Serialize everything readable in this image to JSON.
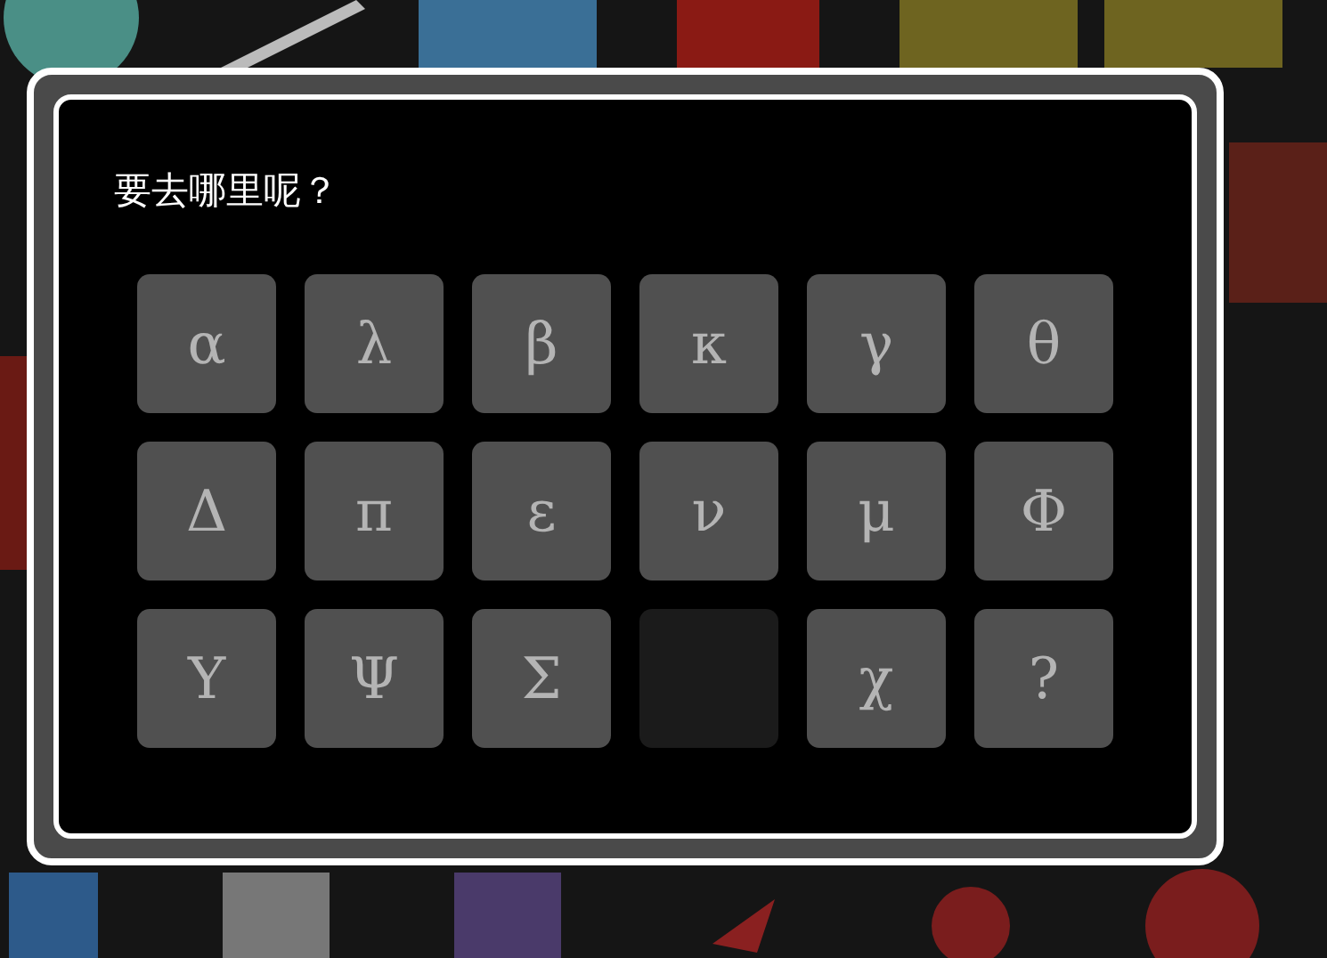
{
  "dialog": {
    "title": "要去哪里呢？",
    "buttons": [
      {
        "label": "α",
        "disabled": false
      },
      {
        "label": "λ",
        "disabled": false
      },
      {
        "label": "β",
        "disabled": false
      },
      {
        "label": "κ",
        "disabled": false
      },
      {
        "label": "γ",
        "disabled": false
      },
      {
        "label": "θ",
        "disabled": false
      },
      {
        "label": "Δ",
        "disabled": false
      },
      {
        "label": "π",
        "disabled": false
      },
      {
        "label": "ε",
        "disabled": false
      },
      {
        "label": "ν",
        "disabled": false
      },
      {
        "label": "μ",
        "disabled": false
      },
      {
        "label": "Φ",
        "disabled": false
      },
      {
        "label": "Υ",
        "disabled": false
      },
      {
        "label": "Ψ",
        "disabled": false
      },
      {
        "label": "Σ",
        "disabled": false
      },
      {
        "disabled": true
      },
      {
        "label": "χ",
        "disabled": false
      },
      {
        "label": "?",
        "disabled": false
      }
    ]
  }
}
